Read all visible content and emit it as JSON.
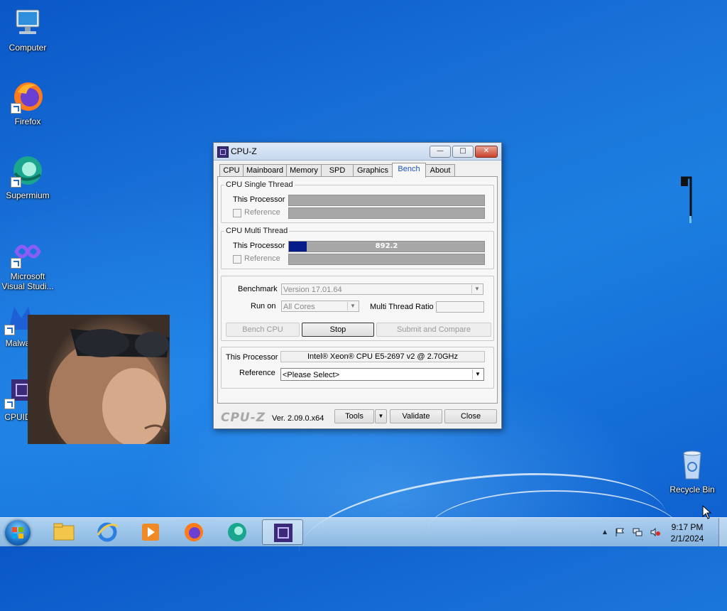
{
  "desktop": {
    "icons": [
      {
        "label": "Computer"
      },
      {
        "label": "Firefox"
      },
      {
        "label": "Supermium"
      },
      {
        "label": "Microsoft Visual Studi..."
      },
      {
        "label": "Malwa..."
      },
      {
        "label": "CPUID..."
      },
      {
        "label": "Recycle Bin"
      }
    ]
  },
  "window": {
    "title": "CPU-Z",
    "controls": {
      "minimize": "—",
      "maximize": "□",
      "close": "✕"
    },
    "tabs": [
      "CPU",
      "Mainboard",
      "Memory",
      "SPD",
      "Graphics",
      "Bench",
      "About"
    ],
    "active_tab": "Bench",
    "single_thread": {
      "legend": "CPU Single Thread",
      "this_processor_label": "This Processor",
      "reference_label": "Reference"
    },
    "multi_thread": {
      "legend": "CPU Multi Thread",
      "this_processor_label": "This Processor",
      "this_processor_value": "892.2",
      "this_processor_fraction": 0.09,
      "reference_label": "Reference"
    },
    "benchmark": {
      "benchmark_label": "Benchmark",
      "benchmark_value": "Version 17.01.64",
      "runon_label": "Run on",
      "runon_value": "All Cores",
      "ratio_label": "Multi Thread Ratio",
      "ratio_value": ""
    },
    "buttons": {
      "bench_cpu": "Bench CPU",
      "stop": "Stop",
      "submit": "Submit and Compare"
    },
    "info": {
      "this_processor_label": "This Processor",
      "this_processor_value": "Intel® Xeon® CPU E5-2697 v2 @ 2.70GHz",
      "reference_label": "Reference",
      "reference_value": "<Please Select>"
    },
    "footer": {
      "logo": "CPU-Z",
      "version": "Ver. 2.09.0.x64",
      "tools": "Tools",
      "tools_arrow": "▼",
      "validate": "Validate",
      "close": "Close"
    }
  },
  "taskbar": {
    "clock_time": "9:17 PM",
    "clock_date": "2/1/2024",
    "tray_arrow": "▲"
  },
  "colors": {
    "accent": "#1c4fbf",
    "bench_fill": "#061a8a",
    "desktop_blue": "#1a73d9"
  }
}
